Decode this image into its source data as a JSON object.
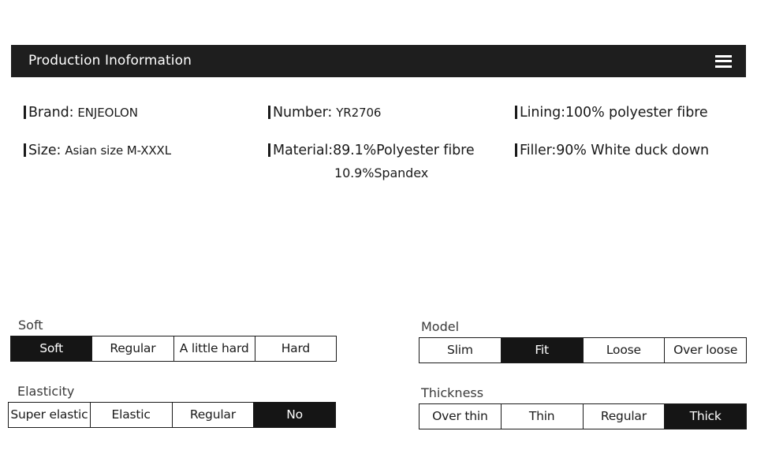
{
  "header": {
    "title": "Production Inoformation",
    "menu_icon": "hamburger-icon"
  },
  "info": {
    "columns": [
      {
        "rows": [
          {
            "label": "Brand:",
            "value": "ENJEOLON",
            "value_size": "small"
          },
          {
            "label": "Size:",
            "value": "Asian size M-XXXL",
            "value_size": "small"
          }
        ]
      },
      {
        "rows": [
          {
            "label": "Number:",
            "value": "YR2706",
            "value_size": "small"
          },
          {
            "label": "Material:",
            "value": "89.1%Polyester fibre",
            "value_size": "big",
            "subline": "10.9%Spandex"
          }
        ]
      },
      {
        "rows": [
          {
            "label": "Lining:",
            "value": "100% polyester fibre",
            "value_size": "big"
          },
          {
            "label": "Filler:",
            "value": "90% White duck down",
            "value_size": "big"
          }
        ]
      }
    ]
  },
  "options": {
    "soft": {
      "label": "Soft",
      "cells": [
        "Soft",
        "Regular",
        "A little hard",
        "Hard"
      ],
      "selected_index": 0
    },
    "elasticity": {
      "label": "Elasticity",
      "cells": [
        "Super elastic",
        "Elastic",
        "Regular",
        "No"
      ],
      "selected_index": 3
    },
    "model": {
      "label": "Model",
      "cells": [
        "Slim",
        "Fit",
        "Loose",
        "Over loose"
      ],
      "selected_index": 1
    },
    "thickness": {
      "label": "Thickness",
      "cells": [
        "Over thin",
        "Thin",
        "Regular",
        "Thick"
      ],
      "selected_index": 3
    }
  },
  "colors": {
    "header_bg": "#1e1e1e",
    "selected_bg": "#151515",
    "text": "#1a1a1a",
    "label_text": "#3a3a3a",
    "page_bg": "#ffffff"
  }
}
